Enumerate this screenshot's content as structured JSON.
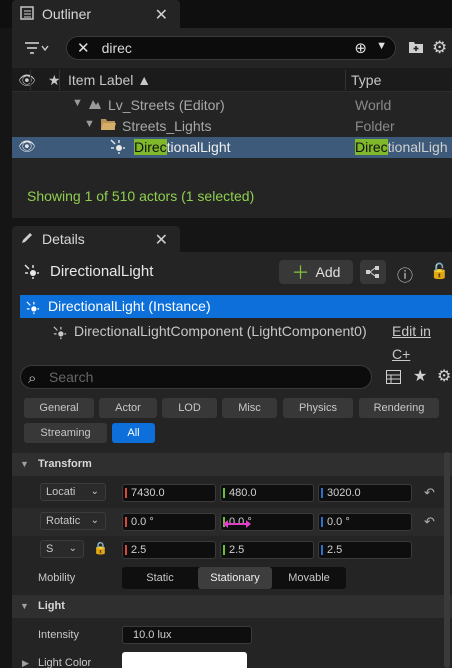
{
  "outliner": {
    "tab_title": "Outliner",
    "search_value": "direc",
    "columns": {
      "item_label": "Item Label ▲",
      "type": "Type"
    },
    "rows": [
      {
        "label": "Lv_Streets (Editor)",
        "type": "World"
      },
      {
        "label": "Streets_Lights",
        "type": "Folder"
      },
      {
        "label_match": "Direc",
        "label_rest": "tionalLight",
        "type_match": "Direc",
        "type_rest": "tionalLigh"
      }
    ],
    "status": "Showing 1 of 510 actors (1 selected)"
  },
  "details": {
    "tab_title": "Details",
    "actor_name": "DirectionalLight",
    "add_label": "Add",
    "components": [
      "DirectionalLight (Instance)",
      "DirectionalLightComponent (LightComponent0)"
    ],
    "edit_link": "Edit in C+",
    "search_placeholder": "Search",
    "filters": [
      "General",
      "Actor",
      "LOD",
      "Misc",
      "Physics",
      "Rendering",
      "Streaming",
      "All"
    ],
    "active_filter": "All",
    "sections": {
      "transform": "Transform",
      "light": "Light"
    },
    "transform": {
      "location_label": "Locati",
      "rotation_label": "Rotatic",
      "scale_label": "S",
      "location": [
        "7430.0",
        "480.0",
        "3020.0"
      ],
      "rotation": [
        "0.0 °",
        "0.0 °",
        "0.0 °"
      ],
      "scale": [
        "2.5",
        "2.5",
        "2.5"
      ],
      "mobility_label": "Mobility",
      "mobility_options": [
        "Static",
        "Stationary",
        "Movable"
      ],
      "mobility_selected": "Stationary"
    },
    "light": {
      "intensity_label": "Intensity",
      "intensity_value": "10.0 lux",
      "color_label": "Light Color",
      "color_hex": "#ffffff"
    }
  },
  "colors": {
    "selection": "#3d5a7a",
    "accent_blue": "#0d6fd9",
    "match_highlight": "#7fb82a",
    "status_green": "#8fcf4e"
  }
}
